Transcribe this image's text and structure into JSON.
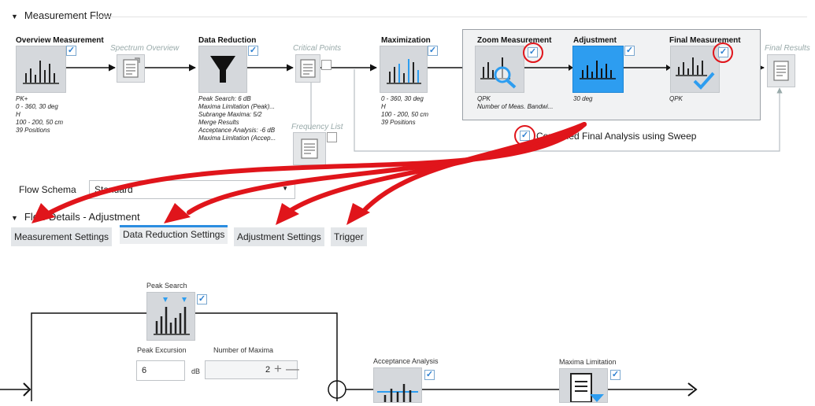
{
  "measurement_flow": {
    "header": "Measurement Flow",
    "nodes": {
      "overview": {
        "title": "Overview Measurement",
        "info": [
          "PK+",
          "0 - 360, 30 deg",
          "H",
          "100 - 200, 50 cm",
          "39 Positions"
        ]
      },
      "spectrum": {
        "title": "Spectrum Overview"
      },
      "data_reduction": {
        "title": "Data Reduction",
        "info": [
          "Peak Search: 6 dB",
          "Maxima Limitation (Peak)...",
          "Subrange Maxima: 5/2",
          "Merge Results",
          "Acceptance Analysis: -6 dB",
          "Maxima Limitation (Accep..."
        ]
      },
      "critical": {
        "title": "Critical Points"
      },
      "frequency_list": {
        "title": "Frequency List"
      },
      "maximization": {
        "title": "Maximization",
        "info": [
          "0 - 360, 30 deg",
          "H",
          "100 - 200, 50 cm",
          "39 Positions"
        ]
      },
      "zoom": {
        "title": "Zoom Measurement",
        "info": [
          "QPK",
          "Number of Meas. Bandwi..."
        ]
      },
      "adjustment": {
        "title": "Adjustment",
        "info": [
          "30 deg"
        ]
      },
      "final_measurement": {
        "title": "Final Measurement",
        "info": [
          "QPK"
        ]
      },
      "final_results": {
        "title": "Final Results"
      }
    },
    "combined_label": "Combined Final Analysis using Sweep"
  },
  "flow_schema": {
    "label": "Flow Schema",
    "value": "Standard"
  },
  "flow_details": {
    "header": "Flow Details  -  Adjustment"
  },
  "tabs": [
    {
      "label": "Measurement Settings"
    },
    {
      "label": "Data Reduction Settings"
    },
    {
      "label": "Adjustment Settings"
    },
    {
      "label": "Trigger"
    }
  ],
  "detail": {
    "peak_search": {
      "title": "Peak Search"
    },
    "peak_excursion": {
      "label": "Peak Excursion",
      "value": "6",
      "unit": "dB"
    },
    "number_of_maxima": {
      "label": "Number of Maxima",
      "value": "2"
    },
    "acceptance_analysis": {
      "title": "Acceptance Analysis"
    },
    "maxima_limitation": {
      "title": "Maxima Limitation"
    }
  },
  "colors": {
    "accent": "#2d9df0",
    "annotation_red": "#e0151b",
    "tab_active": "#2b8de0"
  }
}
